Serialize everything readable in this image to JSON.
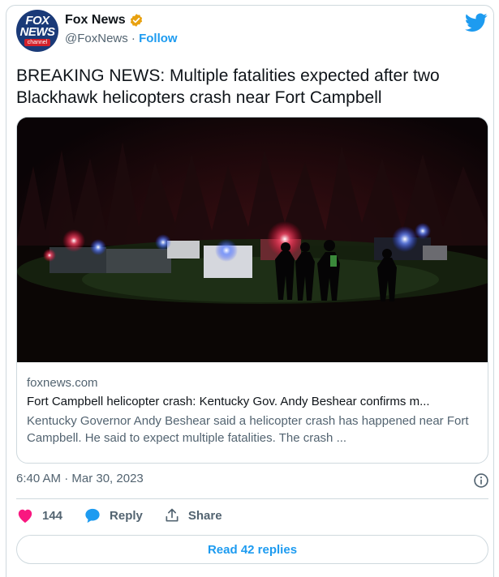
{
  "account": {
    "avatar_line1": "FOX",
    "avatar_line2": "NEWS",
    "avatar_line3": "channel",
    "name": "Fox News",
    "handle": "@FoxNews",
    "separator": "·",
    "follow_label": "Follow",
    "verified_icon": "verified-badge-icon",
    "platform_icon": "twitter-bird-icon"
  },
  "tweet": {
    "text": "BREAKING NEWS: Multiple fatalities expected after two Blackhawk helicopters crash near Fort Campbell"
  },
  "link_card": {
    "domain": "foxnews.com",
    "title": "Fort Campbell helicopter crash: Kentucky Gov. Andy Beshear confirms m...",
    "description": "Kentucky Governor Andy Beshear said a helicopter crash has happened near Fort Campbell. He said to expect multiple fatalities. The crash ..."
  },
  "meta": {
    "timestamp": "6:40 AM · Mar 30, 2023",
    "info_icon": "info-icon"
  },
  "actions": {
    "like_count": "144",
    "reply_label": "Reply",
    "share_label": "Share"
  },
  "read_replies_label": "Read 42 replies",
  "colors": {
    "accent": "#1d9bf0",
    "like": "#f91880",
    "verified": "#e8a10f",
    "border": "#cfd9de",
    "secondary_text": "#536471"
  }
}
